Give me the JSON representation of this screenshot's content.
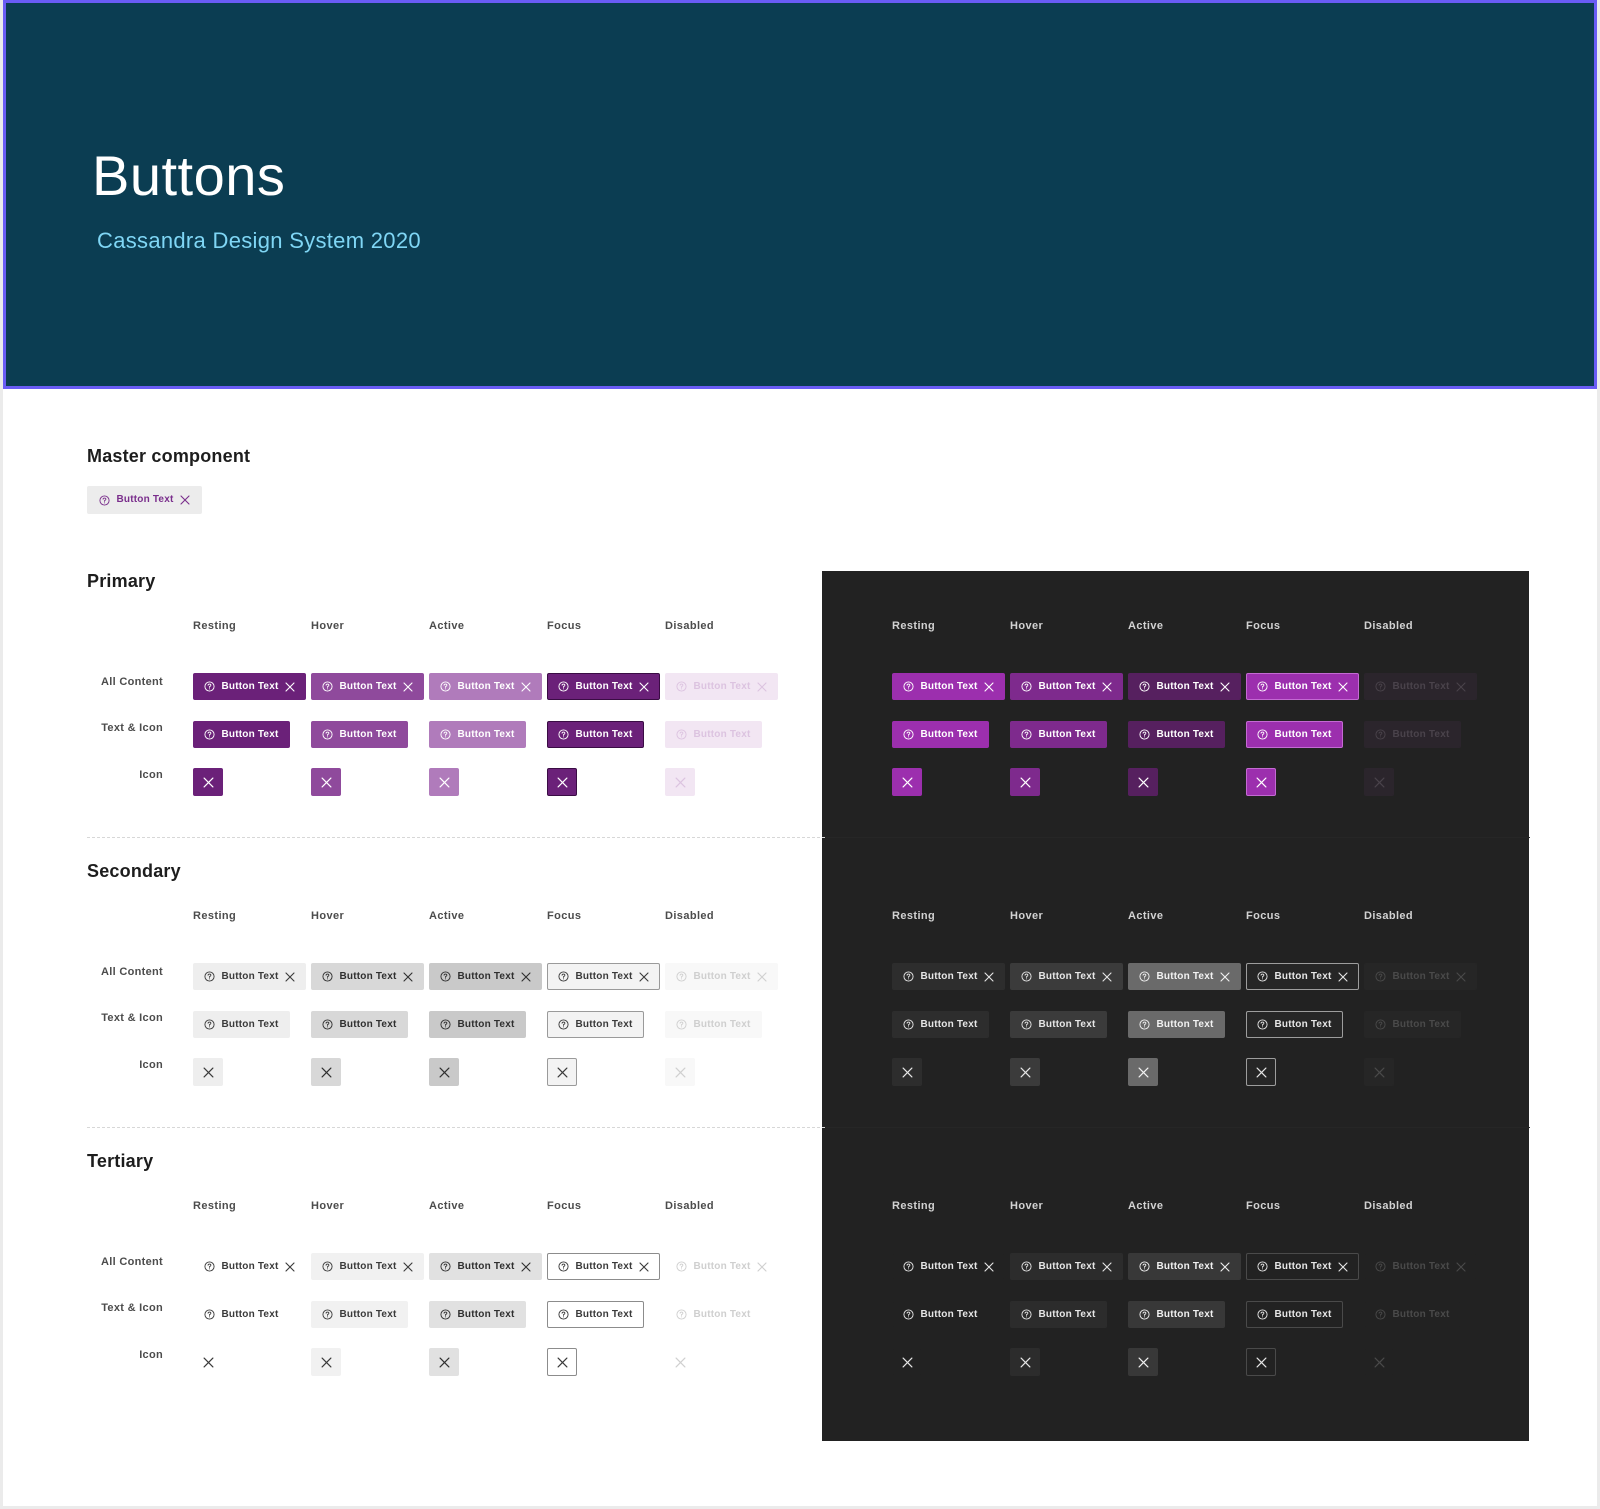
{
  "hero": {
    "title": "Buttons",
    "subtitle": "Cassandra Design System 2020",
    "background": "#0b3d52",
    "border_color": "#6a5cf5",
    "subtitle_color": "#7fd6f5"
  },
  "master": {
    "heading": "Master component",
    "button_label": "Button Text",
    "leading_icon": "help-circle-icon",
    "trailing_icon": "close-icon"
  },
  "states": [
    "Resting",
    "Hover",
    "Active",
    "Focus",
    "Disabled"
  ],
  "rows": [
    "All Content",
    "Text & Icon",
    "Icon"
  ],
  "button_label": "Button Text",
  "sections": [
    {
      "heading": "Primary",
      "light": [
        {
          "bg": "#6b2179",
          "fg": "#ffffff",
          "border": "#6b2179"
        },
        {
          "bg": "#8f4a9c",
          "fg": "#ffffff",
          "border": "#8f4a9c"
        },
        {
          "bg": "#b07bbb",
          "fg": "#ffffff",
          "border": "#b07bbb"
        },
        {
          "bg": "#6b2179",
          "fg": "#ffffff",
          "border": "#3a0c44"
        },
        {
          "bg": "#f2e6f3",
          "fg": "#dcc3e0",
          "border": "#f2e6f3"
        }
      ],
      "dark": [
        {
          "bg": "#9c2fae",
          "fg": "#ffffff",
          "border": "#9c2fae"
        },
        {
          "bg": "#7e2a8d",
          "fg": "#ffffff",
          "border": "#7e2a8d"
        },
        {
          "bg": "#56205f",
          "fg": "#ffffff",
          "border": "#56205f"
        },
        {
          "bg": "#9c2fae",
          "fg": "#ffffff",
          "border": "#c46ad3"
        },
        {
          "bg": "#2b252c",
          "fg": "#4a434b",
          "border": "#2b252c"
        }
      ]
    },
    {
      "heading": "Secondary",
      "light": [
        {
          "bg": "#eeeeee",
          "fg": "#3a3a3a",
          "border": "#eeeeee"
        },
        {
          "bg": "#d8d8d8",
          "fg": "#2f2f2f",
          "border": "#d8d8d8"
        },
        {
          "bg": "#c9c9c9",
          "fg": "#2f2f2f",
          "border": "#c9c9c9"
        },
        {
          "bg": "#f3f3f3",
          "fg": "#3a3a3a",
          "border": "#9a9a9a"
        },
        {
          "bg": "#f8f8f8",
          "fg": "#cfcfcf",
          "border": "#f8f8f8"
        }
      ],
      "dark": [
        {
          "bg": "#2d2d2d",
          "fg": "#e6e6e6",
          "border": "#2d2d2d"
        },
        {
          "bg": "#3b3b3b",
          "fg": "#e6e6e6",
          "border": "#3b3b3b"
        },
        {
          "bg": "#6a6a6a",
          "fg": "#f2f2f2",
          "border": "#6a6a6a"
        },
        {
          "bg": "#262626",
          "fg": "#e6e6e6",
          "border": "#9d9d9d"
        },
        {
          "bg": "#262626",
          "fg": "#4a4a4a",
          "border": "#262626"
        }
      ]
    },
    {
      "heading": "Tertiary",
      "light": [
        {
          "bg": "#ffffff",
          "fg": "#3a3a3a",
          "border": "#ffffff"
        },
        {
          "bg": "#f1f1f1",
          "fg": "#3a3a3a",
          "border": "#f1f1f1"
        },
        {
          "bg": "#e1e1e1",
          "fg": "#2f2f2f",
          "border": "#e1e1e1"
        },
        {
          "bg": "#ffffff",
          "fg": "#3a3a3a",
          "border": "#8c8c8c"
        },
        {
          "bg": "#ffffff",
          "fg": "#cfcfcf",
          "border": "#ffffff"
        }
      ],
      "dark": [
        {
          "bg": "#222222",
          "fg": "#e6e6e6",
          "border": "#222222"
        },
        {
          "bg": "#2c2c2c",
          "fg": "#e6e6e6",
          "border": "#2c2c2c"
        },
        {
          "bg": "#383838",
          "fg": "#f0f0f0",
          "border": "#383838"
        },
        {
          "bg": "#222222",
          "fg": "#e6e6e6",
          "border": "#4a4a4a"
        },
        {
          "bg": "#222222",
          "fg": "#4a4a4a",
          "border": "#222222"
        }
      ]
    }
  ],
  "dark_panel_color": "#222222"
}
